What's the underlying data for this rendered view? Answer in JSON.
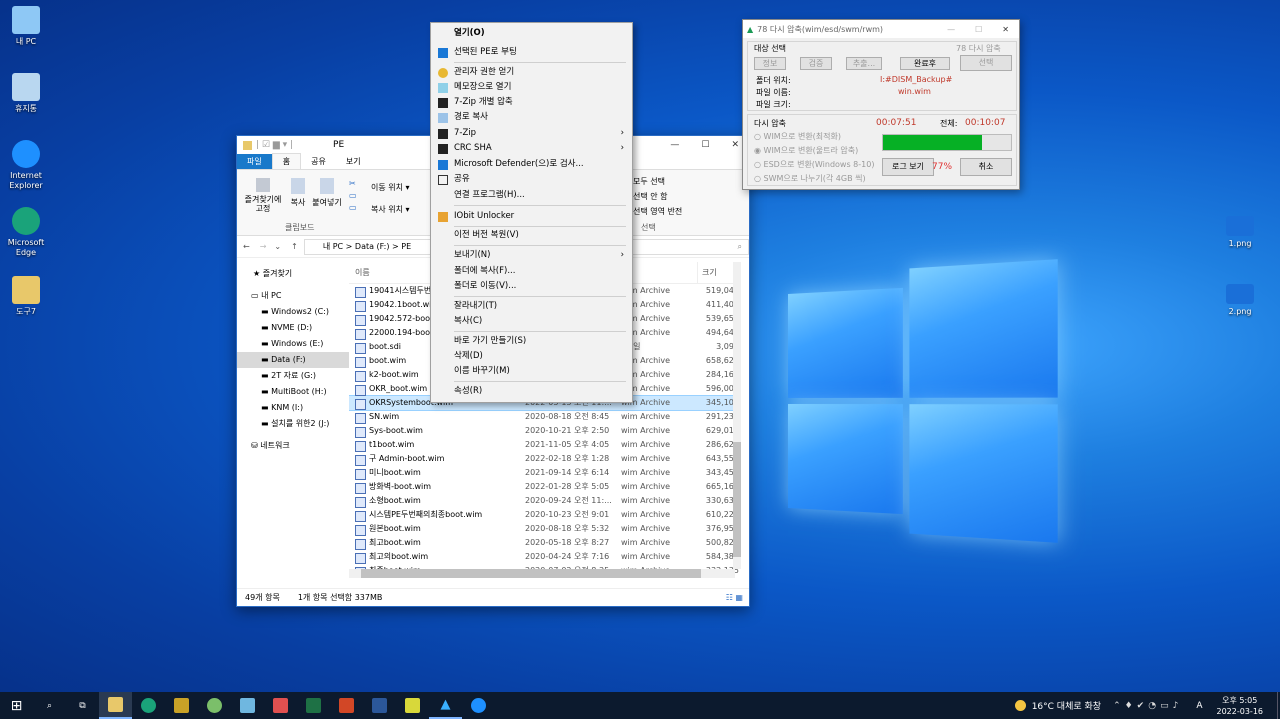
{
  "desktop": {
    "icons": [
      {
        "label": "내 PC",
        "color": "#8ec8f5"
      },
      {
        "label": "휴지통",
        "color": "#b9d7f0"
      },
      {
        "label": "Internet Explorer",
        "color": "#1e90ff"
      },
      {
        "label": "Microsoft Edge",
        "color": "#1aa37a"
      },
      {
        "label": "도구7",
        "color": "#e8c86a"
      },
      {
        "label": "1.png",
        "color": "#1a6fd8"
      },
      {
        "label": "2.png",
        "color": "#1a6fd8"
      }
    ]
  },
  "explorer": {
    "title": "PE",
    "tabs": [
      "파일",
      "홈",
      "공유",
      "보기"
    ],
    "ribbon": {
      "pin": "즐겨찾기에 고정",
      "copy": "복사",
      "paste": "붙여넣기",
      "clipboard": "클립보드",
      "move_to": "이동 위치",
      "copy_to": "복사 위치",
      "select_all": "모두 선택",
      "select_none": "선택 안 함",
      "invert": "선택 영역 반전",
      "select_group": "선택"
    },
    "address": "내 PC  >  Data (F:)  >  PE",
    "search_placeholder": "검색",
    "nav": [
      "즐겨찾기",
      "내 PC",
      "Windows2 (C:)",
      "NVME (D:)",
      "Windows (E:)",
      "Data (F:)",
      "2T 자료 (G:)",
      "MultiBoot (H:)",
      "KNM (I:)",
      "설치를 위한2 (J:)",
      "네트워크"
    ],
    "columns": {
      "name": "이름",
      "type": "형",
      "size": "크기"
    },
    "files": [
      {
        "name": "19041시스템두번",
        "date": "",
        "type": "wim Archive",
        "size": "519,046"
      },
      {
        "name": "19042.1boot.wim",
        "date": "",
        "type": "wim Archive",
        "size": "411,407"
      },
      {
        "name": "19042.572-boot",
        "date": "",
        "type": "wim Archive",
        "size": "539,650"
      },
      {
        "name": "22000.194-boot",
        "date": "",
        "type": "wim Archive",
        "size": "494,640"
      },
      {
        "name": "boot.sdi",
        "date": "",
        "type": "i 파일",
        "size": "3,096"
      },
      {
        "name": "boot.wim",
        "date": "",
        "type": "wim Archive",
        "size": "658,625"
      },
      {
        "name": "k2-boot.wim",
        "date": "",
        "type": "wim Archive",
        "size": "284,162"
      },
      {
        "name": "OKR_boot.wim",
        "date": "",
        "type": "wim Archive",
        "size": "596,007"
      },
      {
        "name": "OKRSystemboot.wim",
        "date": "2022-03-13 오전 11:...",
        "type": "wim Archive",
        "size": "345,100"
      },
      {
        "name": "SN.wim",
        "date": "2020-08-18 오전 8:45",
        "type": "wim Archive",
        "size": "291,237"
      },
      {
        "name": "Sys-boot.wim",
        "date": "2020-10-21 오후 2:50",
        "type": "wim Archive",
        "size": "629,013"
      },
      {
        "name": "t1boot.wim",
        "date": "2021-11-05 오후 4:05",
        "type": "wim Archive",
        "size": "286,629"
      },
      {
        "name": "구 Admin-boot.wim",
        "date": "2022-02-18 오후 1:28",
        "type": "wim Archive",
        "size": "643,551"
      },
      {
        "name": "미니boot.wim",
        "date": "2021-09-14 오후 6:14",
        "type": "wim Archive",
        "size": "343,458"
      },
      {
        "name": "방화벽-boot.wim",
        "date": "2022-01-28 오후 5:05",
        "type": "wim Archive",
        "size": "665,167"
      },
      {
        "name": "소형boot.wim",
        "date": "2020-09-24 오전 11:...",
        "type": "wim Archive",
        "size": "330,637"
      },
      {
        "name": "시스템PE두번째의최종boot.wim",
        "date": "2020-10-23 오전 9:01",
        "type": "wim Archive",
        "size": "610,221"
      },
      {
        "name": "원본boot.wim",
        "date": "2020-08-18 오후 5:32",
        "type": "wim Archive",
        "size": "376,954"
      },
      {
        "name": "최고boot.wim",
        "date": "2020-05-18 오후 8:27",
        "type": "wim Archive",
        "size": "500,824"
      },
      {
        "name": "최고의boot.wim",
        "date": "2020-04-24 오후 7:16",
        "type": "wim Archive",
        "size": "584,387"
      },
      {
        "name": "최종boot.wim",
        "date": "2020-07-02 오전 8:25",
        "type": "wim Archive",
        "size": "332,135"
      }
    ],
    "status_count": "49개 항목",
    "status_selected": "1개 항목 선택함 337MB"
  },
  "context_menu": [
    {
      "label": "열기(O)",
      "bold": true
    },
    {
      "label": "선택된 PE로 부팅"
    },
    {
      "label": "관리자 권한 얻기"
    },
    {
      "label": "메모장으로 열기"
    },
    {
      "label": "7-Zip 개별 압축"
    },
    {
      "label": "경로 복사"
    },
    {
      "label": "7-Zip",
      "sub": true
    },
    {
      "label": "CRC SHA",
      "sub": true
    },
    {
      "label": "Microsoft Defender(으)로 검사..."
    },
    {
      "label": "공유"
    },
    {
      "label": "연결 프로그램(H)..."
    },
    {
      "label": "IObit Unlocker"
    },
    {
      "label": "이전 버전 복원(V)"
    },
    {
      "label": "보내기(N)",
      "sub": true
    },
    {
      "label": "폴더에 복사(F)..."
    },
    {
      "label": "폴더로 이동(V)..."
    },
    {
      "label": "잘라내기(T)"
    },
    {
      "label": "복사(C)"
    },
    {
      "label": "바로 가기 만들기(S)"
    },
    {
      "label": "삭제(D)"
    },
    {
      "label": "이름 바꾸기(M)"
    },
    {
      "label": "속성(R)"
    }
  ],
  "zip_dialog": {
    "title": "78 다시 압축(wim/esd/swm/rwm)",
    "target_group": "대상 선택",
    "version": "78 다시 압축",
    "btn_info": "정보",
    "btn_verify": "검증",
    "btn_extract": "추출...",
    "btn_done": "완료후",
    "btn_select": "선택",
    "folder_label": "폴더 위치:",
    "folder_value": "I:#DISM_Backup#",
    "file_label": "파일 이름:",
    "file_value": "win.wim",
    "size_label": "파일 크기:",
    "recompress_group": "다시 압축",
    "elapsed": "00:07:51",
    "total_label": "전체:",
    "total": "00:10:07",
    "options": [
      "WIM으로 변환(최적화)",
      "WIM으로 변환(울트라 압축)",
      "ESD으로 변환(Windows 8-10)",
      "SWM으로 나누기(각 4GB 씩)"
    ],
    "progress_percent": 77,
    "progress_label": "77%",
    "btn_log": "로그 보기",
    "btn_cancel": "취소"
  },
  "taskbar": {
    "weather": "16°C 대체로 화창",
    "ime": "A",
    "time": "오후 5:05",
    "date": "2022-03-16"
  }
}
